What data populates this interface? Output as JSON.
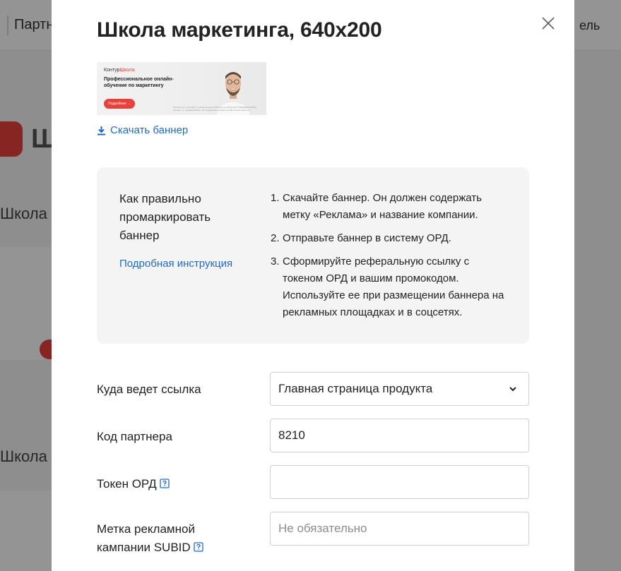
{
  "background": {
    "header_left": "Партн",
    "header_right": "ель",
    "logo_text": "Ш",
    "section1": "Школа м",
    "section2": "Школа м"
  },
  "modal": {
    "title": "Школа маркетинга, 640x200",
    "close_icon": "close-icon",
    "banner": {
      "brand_main": "Контур",
      "brand_accent": "Школа",
      "headline": "Профессиональное онлайн-обучение по маркетингу",
      "cta": "Подробнее →",
      "legal": "Реклама 16+ АНО ДПО «Учебный центр СКБ Контур» ОГРН 1027739083880 620026, Москва, ул. Сущёвский Вал, 18. Подробные условия на сайте kontur-school.ru"
    },
    "download_label": "Скачать баннер",
    "info": {
      "title": "Как правильно промаркировать баннер",
      "link": "Подробная инструкция",
      "steps": [
        {
          "num": "1.",
          "text": "Скачайте баннер. Он должен содержать метку «Реклама» и название компании."
        },
        {
          "num": "2.",
          "text": "Отправьте баннер в систему ОРД."
        },
        {
          "num": "3.",
          "text": "Сформируйте реферальную ссылку с токеном ОРД и вашим промокодом. Используйте ее при размещении баннера на рекламных площадках и в соцсетях."
        }
      ]
    },
    "form": {
      "link_target": {
        "label": "Куда ведет ссылка",
        "value": "Главная страница продукта"
      },
      "partner_code": {
        "label": "Код партнера",
        "value": "8210"
      },
      "ord_token": {
        "label": "Токен ОРД",
        "value": ""
      },
      "subid": {
        "label": "Метка рекламной кампании SUBID",
        "placeholder": "Не обязательно"
      }
    }
  },
  "colors": {
    "accent": "#1f6ac9",
    "brand_red": "#e8413b",
    "info_bg": "#f4f4f4"
  }
}
